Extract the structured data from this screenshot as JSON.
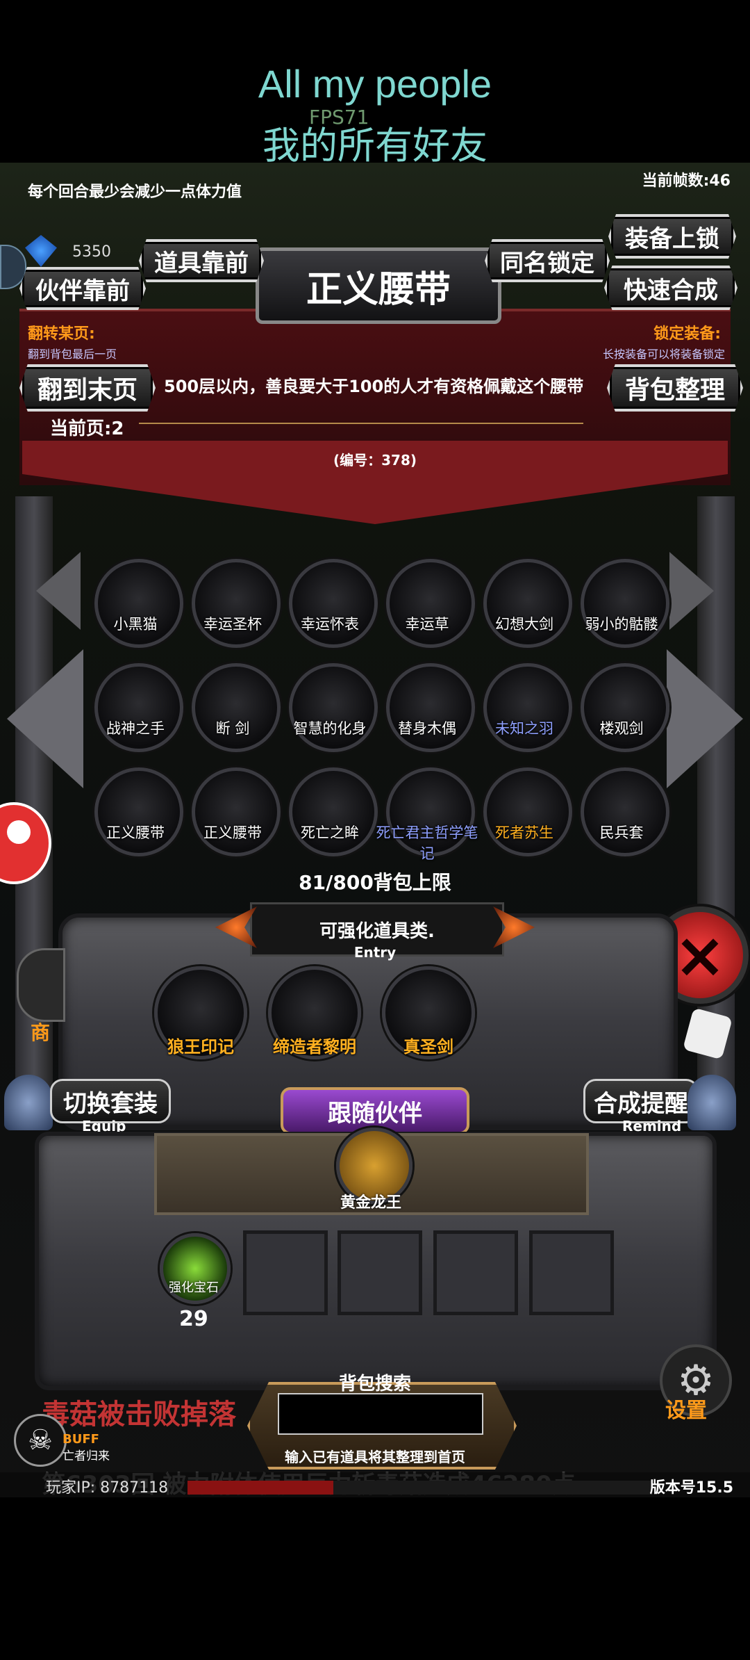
{
  "header": {
    "lyric_en": "All my people",
    "fps_overlay": "FPS71",
    "lyric_zh": "我的所有好友"
  },
  "hud": {
    "hint_text": "每个回合最少会减少一点体力值",
    "fps_count": "当前帧数:46",
    "gem_count": "5350"
  },
  "toolbar": {
    "partner_front": "伙伴靠前",
    "item_front": "道具靠前",
    "same_name_lock": "同名锁定",
    "equip_lock": "装备上锁",
    "quick_merge": "快速合成",
    "jump_last": "翻到末页",
    "bag_sort": "背包整理"
  },
  "item_panel": {
    "title": "正义腰带",
    "flip_label": "翻转某页:",
    "flip_desc": "翻到背包最后一页",
    "lock_label": "锁定装备:",
    "lock_desc": "长按装备可以将装备锁定",
    "description": "500层以内，善良要大于100的人才有资格佩戴这个腰带",
    "current_page": "当前页:2",
    "item_id": "(编号：378)"
  },
  "inventory": {
    "items": [
      {
        "label": "小黑猫",
        "icon": "black-cat-icon",
        "color": "#ffffff"
      },
      {
        "label": "幸运圣杯",
        "icon": "holy-grail-icon",
        "color": "#ffffff"
      },
      {
        "label": "幸运怀表",
        "icon": "pocket-watch-icon",
        "color": "#ffffff"
      },
      {
        "label": "幸运草",
        "icon": "clover-icon",
        "color": "#ffffff"
      },
      {
        "label": "幻想大剑",
        "icon": "fantasy-sword-icon",
        "color": "#ffffff"
      },
      {
        "label": "弱小的骷髅",
        "icon": "skeleton-icon",
        "color": "#ffffff"
      },
      {
        "label": "战神之手",
        "icon": "war-hand-icon",
        "color": "#ffffff"
      },
      {
        "label": "断 剑",
        "icon": "broken-sword-icon",
        "color": "#ffffff"
      },
      {
        "label": "智慧的化身",
        "icon": "wisdom-avatar-icon",
        "color": "#ffffff"
      },
      {
        "label": "替身木偶",
        "icon": "wooden-puppet-icon",
        "color": "#ffffff"
      },
      {
        "label": "未知之羽",
        "icon": "feather-icon",
        "color": "#8fa0ff"
      },
      {
        "label": "楼观剑",
        "icon": "katana-icon",
        "color": "#ffffff"
      },
      {
        "label": "正义腰带",
        "icon": "belt-icon",
        "color": "#ffffff"
      },
      {
        "label": "正义腰带",
        "icon": "belt-icon",
        "color": "#ffffff"
      },
      {
        "label": "死亡之眸",
        "icon": "gold-orb-icon",
        "color": "#ffffff"
      },
      {
        "label": "死亡君主哲学笔记",
        "icon": "notebook-icon",
        "color": "#8fa0ff"
      },
      {
        "label": "死者苏生",
        "icon": "resurrection-icon",
        "color": "#ffb020"
      },
      {
        "label": "民兵套",
        "icon": "militia-set-icon",
        "color": "#ffffff"
      }
    ],
    "capacity": "81/800背包上限"
  },
  "enhance": {
    "category": "可强化道具类.",
    "entry": "Entry",
    "items": [
      {
        "label": "狼王印记",
        "icon": "wolf-king-mark-icon",
        "color": "#ffb020"
      },
      {
        "label": "缔造者黎明",
        "icon": "creator-dawn-icon",
        "color": "#ffb020"
      },
      {
        "label": "真圣剑",
        "icon": "holy-sword-icon",
        "color": "#ffb020"
      }
    ]
  },
  "equip_bar": {
    "switch_set": "切换套装",
    "switch_sub": "Equip",
    "follow_partner": "跟随伙伴",
    "merge_remind": "合成提醒",
    "remind_sub": "Remind",
    "partner_name": "黄金龙王"
  },
  "material": {
    "name": "强化宝石",
    "count": "29"
  },
  "side": {
    "shop": "商",
    "settings": "设置"
  },
  "search": {
    "title": "背包搜索",
    "placeholder": "",
    "hint": "输入已有道具将其整理到首页"
  },
  "footer": {
    "scroll_text": "毒菇被击败掉落",
    "buff_label": "BUFF",
    "buff_name": "亡者归来",
    "ip": "玩家IP:  8787118",
    "version": "版本号15.5",
    "log_text": "第6303回 被力附体使用巨力斩毒菇造成46280点"
  },
  "colors": {
    "accent_orange": "#ff9a1a",
    "label_blue": "#8fa0ff",
    "panel_red": "#6b1518"
  }
}
